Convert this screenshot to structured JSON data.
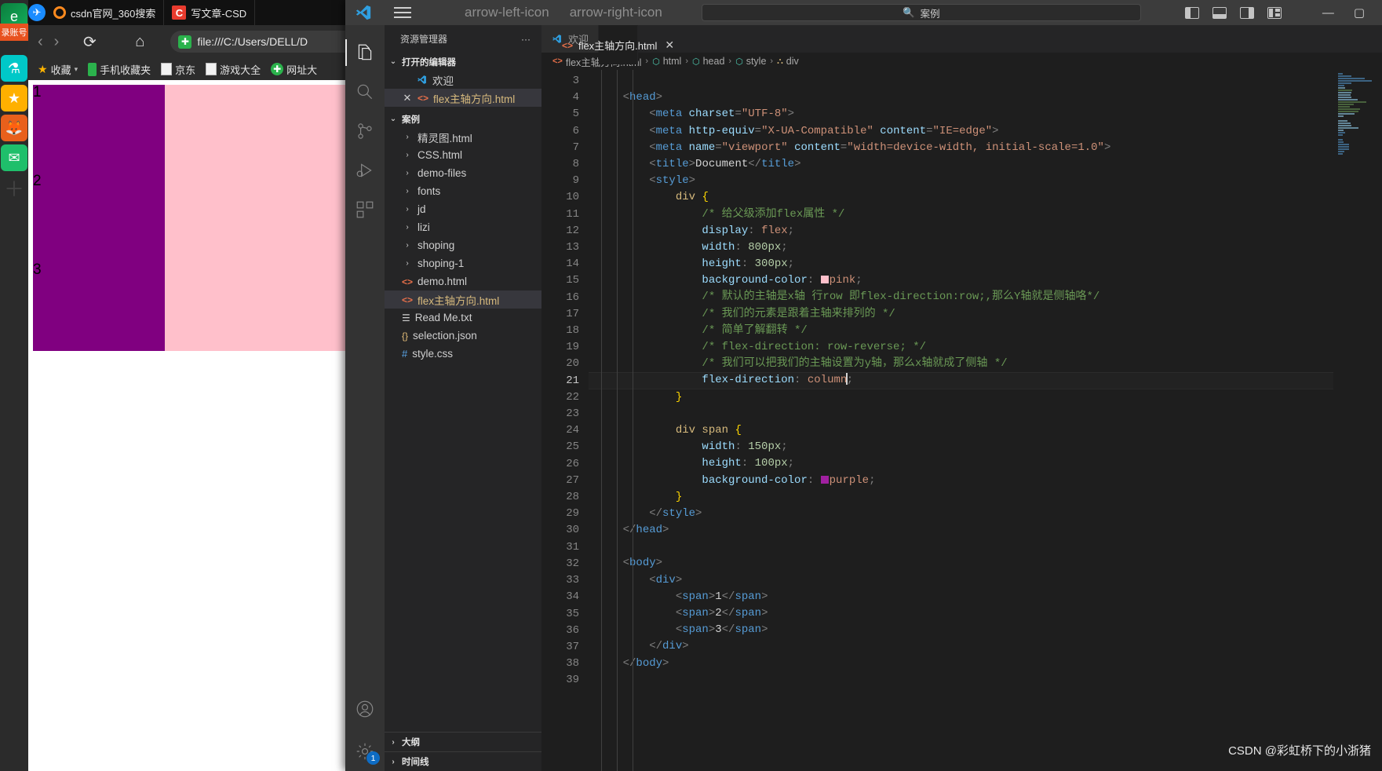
{
  "browser": {
    "tabs": [
      {
        "label": "csdn官网_360搜索",
        "icon": "search-circle-icon"
      },
      {
        "label": "写文章-CSD",
        "icon": "csdn-c-icon"
      }
    ],
    "nav": {
      "back": "‹",
      "forward": "›",
      "reload": "⟳",
      "home": "⌂"
    },
    "url": "file:///C:/Users/DELL/D",
    "url_shield_icon": "shield-icon",
    "bookmarks": [
      {
        "label": "收藏",
        "icon": "star-icon"
      },
      {
        "label": "手机收藏夹",
        "icon": "phone-icon"
      },
      {
        "label": "京东",
        "icon": "page-icon"
      },
      {
        "label": "游戏大全",
        "icon": "page-icon"
      },
      {
        "label": "网址大",
        "icon": "globe-icon"
      }
    ],
    "sidebar_icons": [
      "edge-icon",
      "lab-icon",
      "star-icon",
      "fox-icon",
      "mail-icon",
      "plus-icon"
    ],
    "login_badge": "录账号",
    "page": {
      "container_color": "#FFC0CB",
      "item_color": "#800080",
      "items": [
        "1",
        "2",
        "3"
      ]
    }
  },
  "vscode": {
    "titlebar": {
      "logo_icon": "vscode-logo-icon",
      "menu_icon": "hamburger-icon",
      "back_icon": "arrow-left-icon",
      "forward_icon": "arrow-right-icon",
      "search_placeholder": "案例",
      "search_icon": "search-icon",
      "layout_icons": [
        "panel-left-icon",
        "panel-bottom-icon",
        "panel-right-icon",
        "customize-layout-icon"
      ],
      "minimize": "—",
      "maximize": "▢"
    },
    "activitybar": [
      {
        "name": "explorer",
        "icon": "files-icon",
        "selected": true
      },
      {
        "name": "search",
        "icon": "search-icon",
        "selected": false
      },
      {
        "name": "source-control",
        "icon": "source-control-icon",
        "selected": false
      },
      {
        "name": "run-debug",
        "icon": "run-debug-icon",
        "selected": false
      },
      {
        "name": "extensions",
        "icon": "extensions-icon",
        "selected": false
      },
      {
        "name": "accounts",
        "icon": "account-icon",
        "selected": false
      },
      {
        "name": "settings",
        "icon": "gear-icon",
        "selected": false,
        "badge": "1"
      }
    ],
    "sidebar": {
      "title": "资源管理器",
      "more_icon": "ellipsis-icon",
      "open_editors": {
        "label": "打开的编辑器",
        "items": [
          {
            "label": "欢迎",
            "icon": "vscode-logo-icon",
            "close": ""
          },
          {
            "label": "flex主轴方向.html",
            "icon": "html-icon",
            "close": "✕",
            "selected": true
          }
        ]
      },
      "folder": {
        "label": "案例",
        "items": [
          {
            "label": "精灵图.html",
            "type": "folder"
          },
          {
            "label": "CSS.html",
            "type": "folder"
          },
          {
            "label": "demo-files",
            "type": "folder"
          },
          {
            "label": "fonts",
            "type": "folder"
          },
          {
            "label": "jd",
            "type": "folder"
          },
          {
            "label": "lizi",
            "type": "folder"
          },
          {
            "label": "shoping",
            "type": "folder"
          },
          {
            "label": "shoping-1",
            "type": "folder"
          },
          {
            "label": "demo.html",
            "type": "html"
          },
          {
            "label": "flex主轴方向.html",
            "type": "html",
            "selected": true
          },
          {
            "label": "Read Me.txt",
            "type": "txt"
          },
          {
            "label": "selection.json",
            "type": "json"
          },
          {
            "label": "style.css",
            "type": "css"
          }
        ]
      },
      "panels": [
        {
          "label": "大纲"
        },
        {
          "label": "时间线"
        }
      ]
    },
    "editor": {
      "tabs": [
        {
          "label": "欢迎",
          "icon": "vscode-logo-icon",
          "active": false
        },
        {
          "label": "flex主轴方向.html",
          "icon": "html-icon",
          "active": true,
          "close": "✕"
        }
      ],
      "breadcrumb": [
        {
          "label": "flex主轴方向.html",
          "icon": "html-icon"
        },
        {
          "label": "html",
          "icon": "symbol-icon"
        },
        {
          "label": "head",
          "icon": "symbol-icon"
        },
        {
          "label": "style",
          "icon": "symbol-icon"
        },
        {
          "label": "div",
          "icon": "css-symbol-icon"
        }
      ],
      "first_line_number": 3,
      "active_line": 21,
      "lines": [
        {
          "n": 3,
          "tokens": []
        },
        {
          "n": 4,
          "tokens": [
            {
              "t": "punc",
              "v": "    <"
            },
            {
              "t": "tagname",
              "v": "head"
            },
            {
              "t": "punc",
              "v": ">"
            }
          ]
        },
        {
          "n": 5,
          "tokens": [
            {
              "t": "punc",
              "v": "        <"
            },
            {
              "t": "tagname",
              "v": "meta"
            },
            {
              "t": "white",
              "v": " "
            },
            {
              "t": "attr",
              "v": "charset"
            },
            {
              "t": "punc",
              "v": "="
            },
            {
              "t": "str",
              "v": "\"UTF-8\""
            },
            {
              "t": "punc",
              "v": ">"
            }
          ]
        },
        {
          "n": 6,
          "tokens": [
            {
              "t": "punc",
              "v": "        <"
            },
            {
              "t": "tagname",
              "v": "meta"
            },
            {
              "t": "white",
              "v": " "
            },
            {
              "t": "attr",
              "v": "http-equiv"
            },
            {
              "t": "punc",
              "v": "="
            },
            {
              "t": "str",
              "v": "\"X-UA-Compatible\""
            },
            {
              "t": "white",
              "v": " "
            },
            {
              "t": "attr",
              "v": "content"
            },
            {
              "t": "punc",
              "v": "="
            },
            {
              "t": "str",
              "v": "\"IE=edge\""
            },
            {
              "t": "punc",
              "v": ">"
            }
          ]
        },
        {
          "n": 7,
          "tokens": [
            {
              "t": "punc",
              "v": "        <"
            },
            {
              "t": "tagname",
              "v": "meta"
            },
            {
              "t": "white",
              "v": " "
            },
            {
              "t": "attr",
              "v": "name"
            },
            {
              "t": "punc",
              "v": "="
            },
            {
              "t": "str",
              "v": "\"viewport\""
            },
            {
              "t": "white",
              "v": " "
            },
            {
              "t": "attr",
              "v": "content"
            },
            {
              "t": "punc",
              "v": "="
            },
            {
              "t": "str",
              "v": "\"width=device-width, initial-scale=1.0\""
            },
            {
              "t": "punc",
              "v": ">"
            }
          ]
        },
        {
          "n": 8,
          "tokens": [
            {
              "t": "punc",
              "v": "        <"
            },
            {
              "t": "tagname",
              "v": "title"
            },
            {
              "t": "punc",
              "v": ">"
            },
            {
              "t": "white",
              "v": "Document"
            },
            {
              "t": "punc",
              "v": "</"
            },
            {
              "t": "tagname",
              "v": "title"
            },
            {
              "t": "punc",
              "v": ">"
            }
          ]
        },
        {
          "n": 9,
          "tokens": [
            {
              "t": "punc",
              "v": "        <"
            },
            {
              "t": "tagname",
              "v": "style"
            },
            {
              "t": "punc",
              "v": ">"
            }
          ]
        },
        {
          "n": 10,
          "tokens": [
            {
              "t": "white",
              "v": "            "
            },
            {
              "t": "sel",
              "v": "div"
            },
            {
              "t": "white",
              "v": " "
            },
            {
              "t": "brace",
              "v": "{"
            }
          ]
        },
        {
          "n": 11,
          "tokens": [
            {
              "t": "com",
              "v": "                /* 给父级添加flex属性 */"
            }
          ]
        },
        {
          "n": 12,
          "tokens": [
            {
              "t": "white",
              "v": "                "
            },
            {
              "t": "prop",
              "v": "display"
            },
            {
              "t": "punc",
              "v": ": "
            },
            {
              "t": "val",
              "v": "flex"
            },
            {
              "t": "punc",
              "v": ";"
            }
          ]
        },
        {
          "n": 13,
          "tokens": [
            {
              "t": "white",
              "v": "                "
            },
            {
              "t": "prop",
              "v": "width"
            },
            {
              "t": "punc",
              "v": ": "
            },
            {
              "t": "num",
              "v": "800px"
            },
            {
              "t": "punc",
              "v": ";"
            }
          ]
        },
        {
          "n": 14,
          "tokens": [
            {
              "t": "white",
              "v": "                "
            },
            {
              "t": "prop",
              "v": "height"
            },
            {
              "t": "punc",
              "v": ": "
            },
            {
              "t": "num",
              "v": "300px"
            },
            {
              "t": "punc",
              "v": ";"
            }
          ]
        },
        {
          "n": 15,
          "tokens": [
            {
              "t": "white",
              "v": "                "
            },
            {
              "t": "prop",
              "v": "background-color"
            },
            {
              "t": "punc",
              "v": ": "
            },
            {
              "t": "swatch",
              "v": "#FFC0CB"
            },
            {
              "t": "val",
              "v": "pink"
            },
            {
              "t": "punc",
              "v": ";"
            }
          ]
        },
        {
          "n": 16,
          "tokens": [
            {
              "t": "com",
              "v": "                /* 默认的主轴是x轴 行row 即flex-direction:row;,那么Y轴就是侧轴咯*/"
            }
          ]
        },
        {
          "n": 17,
          "tokens": [
            {
              "t": "com",
              "v": "                /* 我们的元素是跟着主轴来排列的 */"
            }
          ]
        },
        {
          "n": 18,
          "tokens": [
            {
              "t": "com",
              "v": "                /* 简单了解翻转 */"
            }
          ]
        },
        {
          "n": 19,
          "tokens": [
            {
              "t": "com",
              "v": "                /* flex-direction: row-reverse; */"
            }
          ]
        },
        {
          "n": 20,
          "tokens": [
            {
              "t": "com",
              "v": "                /* 我们可以把我们的主轴设置为y轴，那么x轴就成了侧轴 */"
            }
          ]
        },
        {
          "n": 21,
          "tokens": [
            {
              "t": "white",
              "v": "                "
            },
            {
              "t": "prop",
              "v": "flex-direction"
            },
            {
              "t": "punc",
              "v": ": "
            },
            {
              "t": "val",
              "v": "column"
            },
            {
              "t": "cursor",
              "v": ""
            },
            {
              "t": "punc",
              "v": ";"
            }
          ]
        },
        {
          "n": 22,
          "tokens": [
            {
              "t": "white",
              "v": "            "
            },
            {
              "t": "brace",
              "v": "}"
            }
          ]
        },
        {
          "n": 23,
          "tokens": []
        },
        {
          "n": 24,
          "tokens": [
            {
              "t": "white",
              "v": "            "
            },
            {
              "t": "sel",
              "v": "div span"
            },
            {
              "t": "white",
              "v": " "
            },
            {
              "t": "brace",
              "v": "{"
            }
          ]
        },
        {
          "n": 25,
          "tokens": [
            {
              "t": "white",
              "v": "                "
            },
            {
              "t": "prop",
              "v": "width"
            },
            {
              "t": "punc",
              "v": ": "
            },
            {
              "t": "num",
              "v": "150px"
            },
            {
              "t": "punc",
              "v": ";"
            }
          ]
        },
        {
          "n": 26,
          "tokens": [
            {
              "t": "white",
              "v": "                "
            },
            {
              "t": "prop",
              "v": "height"
            },
            {
              "t": "punc",
              "v": ": "
            },
            {
              "t": "num",
              "v": "100px"
            },
            {
              "t": "punc",
              "v": ";"
            }
          ]
        },
        {
          "n": 27,
          "tokens": [
            {
              "t": "white",
              "v": "                "
            },
            {
              "t": "prop",
              "v": "background-color"
            },
            {
              "t": "punc",
              "v": ": "
            },
            {
              "t": "swatch",
              "v": "#A020A0"
            },
            {
              "t": "val",
              "v": "purple"
            },
            {
              "t": "punc",
              "v": ";"
            }
          ]
        },
        {
          "n": 28,
          "tokens": [
            {
              "t": "white",
              "v": "            "
            },
            {
              "t": "brace",
              "v": "}"
            }
          ]
        },
        {
          "n": 29,
          "tokens": [
            {
              "t": "punc",
              "v": "        </"
            },
            {
              "t": "tagname",
              "v": "style"
            },
            {
              "t": "punc",
              "v": ">"
            }
          ]
        },
        {
          "n": 30,
          "tokens": [
            {
              "t": "punc",
              "v": "    </"
            },
            {
              "t": "tagname",
              "v": "head"
            },
            {
              "t": "punc",
              "v": ">"
            }
          ]
        },
        {
          "n": 31,
          "tokens": []
        },
        {
          "n": 32,
          "tokens": [
            {
              "t": "punc",
              "v": "    <"
            },
            {
              "t": "tagname",
              "v": "body"
            },
            {
              "t": "punc",
              "v": ">"
            }
          ]
        },
        {
          "n": 33,
          "tokens": [
            {
              "t": "punc",
              "v": "        <"
            },
            {
              "t": "tagname",
              "v": "div"
            },
            {
              "t": "punc",
              "v": ">"
            }
          ]
        },
        {
          "n": 34,
          "tokens": [
            {
              "t": "punc",
              "v": "            <"
            },
            {
              "t": "tagname",
              "v": "span"
            },
            {
              "t": "punc",
              "v": ">"
            },
            {
              "t": "white",
              "v": "1"
            },
            {
              "t": "punc",
              "v": "</"
            },
            {
              "t": "tagname",
              "v": "span"
            },
            {
              "t": "punc",
              "v": ">"
            }
          ]
        },
        {
          "n": 35,
          "tokens": [
            {
              "t": "punc",
              "v": "            <"
            },
            {
              "t": "tagname",
              "v": "span"
            },
            {
              "t": "punc",
              "v": ">"
            },
            {
              "t": "white",
              "v": "2"
            },
            {
              "t": "punc",
              "v": "</"
            },
            {
              "t": "tagname",
              "v": "span"
            },
            {
              "t": "punc",
              "v": ">"
            }
          ]
        },
        {
          "n": 36,
          "tokens": [
            {
              "t": "punc",
              "v": "            <"
            },
            {
              "t": "tagname",
              "v": "span"
            },
            {
              "t": "punc",
              "v": ">"
            },
            {
              "t": "white",
              "v": "3"
            },
            {
              "t": "punc",
              "v": "</"
            },
            {
              "t": "tagname",
              "v": "span"
            },
            {
              "t": "punc",
              "v": ">"
            }
          ]
        },
        {
          "n": 37,
          "tokens": [
            {
              "t": "punc",
              "v": "        </"
            },
            {
              "t": "tagname",
              "v": "div"
            },
            {
              "t": "punc",
              "v": ">"
            }
          ]
        },
        {
          "n": 38,
          "tokens": [
            {
              "t": "punc",
              "v": "    </"
            },
            {
              "t": "tagname",
              "v": "body"
            },
            {
              "t": "punc",
              "v": ">"
            }
          ]
        },
        {
          "n": 39,
          "tokens": []
        }
      ]
    },
    "watermark": "CSDN @彩虹桥下的小浙猪"
  }
}
